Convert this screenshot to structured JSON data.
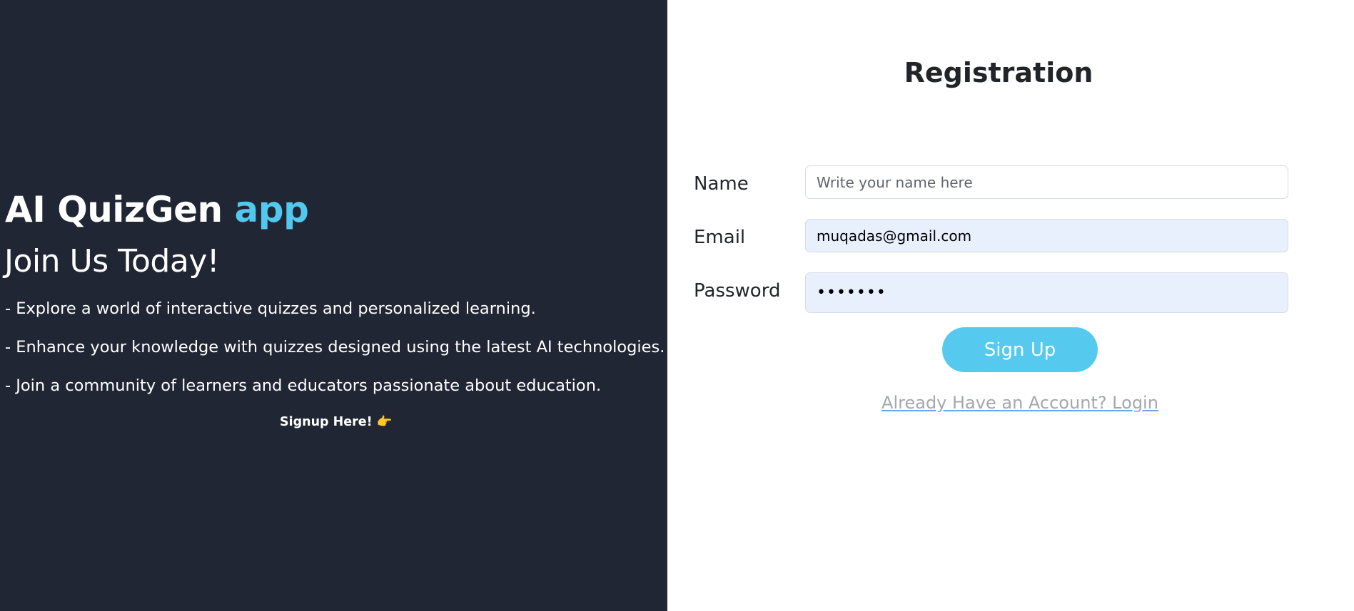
{
  "left_panel": {
    "brand_main": "AI QuizGen",
    "brand_accent": "app",
    "tagline": "Join Us Today!",
    "features": [
      "- Explore a world of interactive quizzes and personalized learning.",
      "- Enhance your knowledge with quizzes designed using the latest AI technologies.",
      "- Join a community of learners and educators passionate about education."
    ],
    "signup_here": "Signup Here!",
    "signup_here_icon": "👉"
  },
  "form": {
    "title": "Registration",
    "name_label": "Name",
    "name_placeholder": "Write your name here",
    "name_value": "",
    "email_label": "Email",
    "email_value": "muqadas@gmail.com",
    "password_label": "Password",
    "password_value": "1234567",
    "signup_button": "Sign Up",
    "login_link": "Already Have an Account? Login"
  },
  "colors": {
    "left_background": "#212634",
    "accent": "#52c8ef",
    "button": "#56c9ef",
    "autofill_background": "#e8f0fe"
  }
}
